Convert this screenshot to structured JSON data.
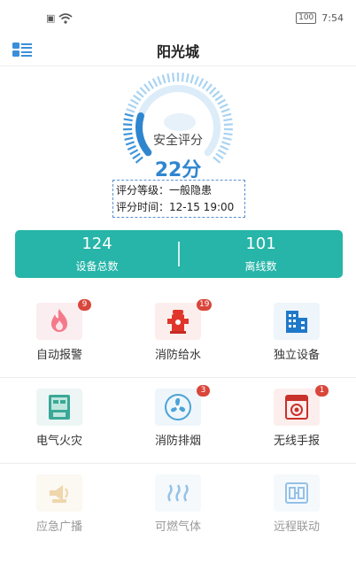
{
  "status_bar": {
    "time": "7:54",
    "battery": "100"
  },
  "header": {
    "title": "阳光城"
  },
  "gauge": {
    "label": "安全评分",
    "score": "22分",
    "value": 22,
    "max": 100
  },
  "score_info": {
    "level_label": "评分等级：一般隐患",
    "time_label": "评分时间：12-15 19:00"
  },
  "stats": {
    "devices": {
      "value": "124",
      "label": "设备总数"
    },
    "offline": {
      "value": "101",
      "label": "离线数"
    }
  },
  "grid": [
    [
      {
        "label": "自动报警",
        "icon": "flame-icon",
        "badge": "9"
      },
      {
        "label": "消防给水",
        "icon": "fire-hydrant-icon",
        "badge": "19"
      },
      {
        "label": "独立设备",
        "icon": "buildings-icon",
        "badge": ""
      }
    ],
    [
      {
        "label": "电气火灾",
        "icon": "electric-cabinet-icon",
        "badge": ""
      },
      {
        "label": "消防排烟",
        "icon": "fan-icon",
        "badge": "3"
      },
      {
        "label": "无线手报",
        "icon": "fire-alarm-panel-icon",
        "badge": "1"
      }
    ],
    [
      {
        "label": "应急广播",
        "icon": "broadcast-icon",
        "badge": ""
      },
      {
        "label": "可燃气体",
        "icon": "gas-waves-icon",
        "badge": ""
      },
      {
        "label": "远程联动",
        "icon": "linkage-icon",
        "badge": ""
      }
    ]
  ],
  "colors": {
    "accent": "#26b5a8",
    "gauge_blue": "#2f86cf",
    "badge": "#d9463b"
  }
}
